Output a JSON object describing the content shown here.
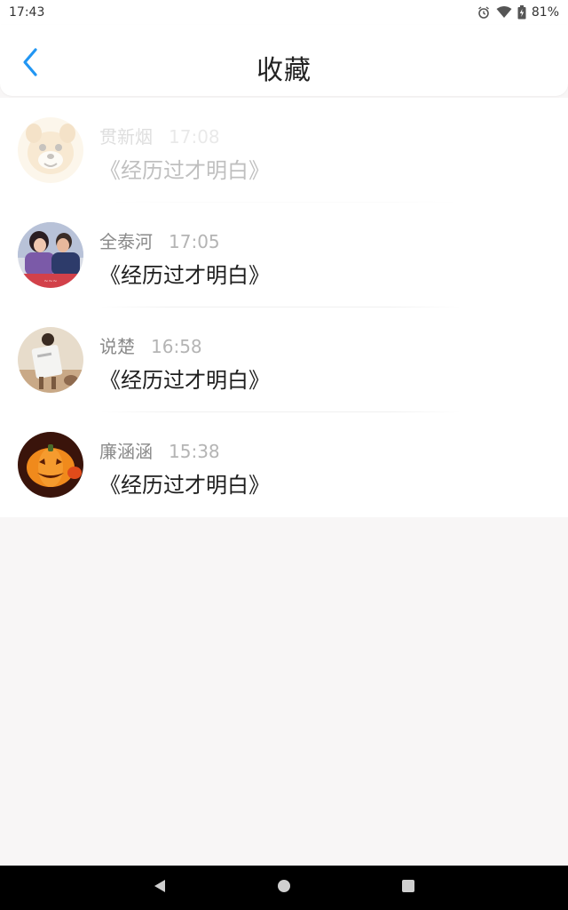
{
  "status": {
    "time": "17:43",
    "battery": "81%",
    "icons": [
      "alarm-icon",
      "wifi-icon",
      "battery-icon"
    ]
  },
  "header": {
    "title": "收藏",
    "back_icon": "chevron-left-icon",
    "accent": "#2196F3"
  },
  "items": [
    {
      "name": "贯新烟",
      "time": "17:08",
      "song": "《经历过才明白》",
      "avatar": "dog-avatar"
    },
    {
      "name": "全泰河",
      "time": "17:05",
      "song": "《经历过才明白》",
      "avatar": "couple-photo-avatar"
    },
    {
      "name": "说楚",
      "time": "16:58",
      "song": "《经历过才明白》",
      "avatar": "person-photo-avatar"
    },
    {
      "name": "廉涵涵",
      "time": "15:38",
      "song": "《经历过才明白》",
      "avatar": "pumpkin-avatar"
    }
  ],
  "navbar": {
    "icons": [
      "back-triangle-icon",
      "home-circle-icon",
      "recents-square-icon"
    ]
  }
}
